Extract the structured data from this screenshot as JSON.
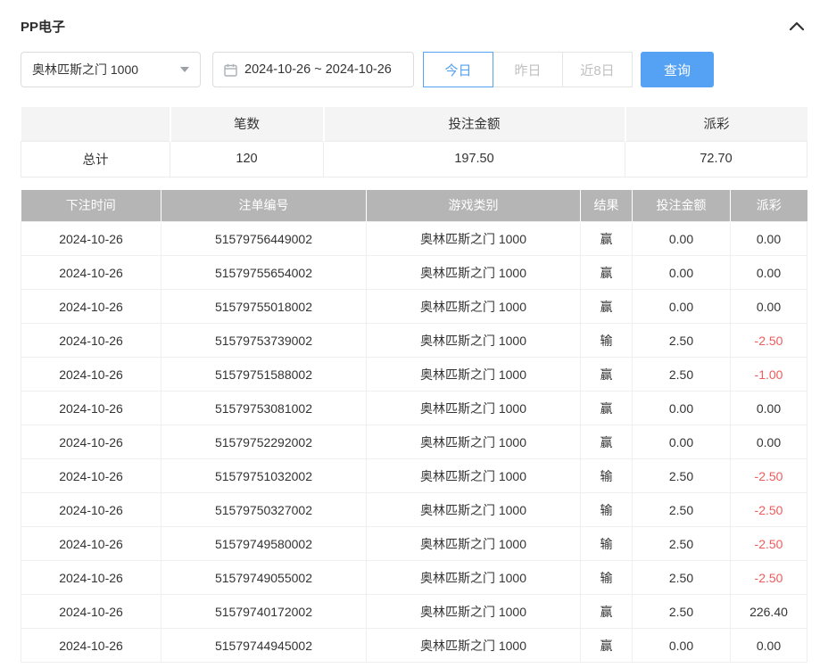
{
  "header": {
    "title": "PP电子"
  },
  "filters": {
    "game_select": {
      "value": "奥林匹斯之门 1000"
    },
    "date_range": {
      "value": "2024-10-26 ~ 2024-10-26"
    },
    "quick_buttons": [
      {
        "label": "今日",
        "active": true
      },
      {
        "label": "昨日",
        "active": false
      },
      {
        "label": "近8日",
        "active": false
      }
    ],
    "query_label": "查询"
  },
  "summary": {
    "columns": {
      "count": "笔数",
      "bet_amount": "投注金额",
      "payout": "派彩"
    },
    "total": {
      "label": "总计",
      "count": "120",
      "bet_amount": "197.50",
      "payout": "72.70"
    }
  },
  "table": {
    "columns": {
      "date": "下注时间",
      "order_id": "注单编号",
      "game": "游戏类别",
      "result": "结果",
      "bet": "投注金额",
      "payout": "派彩"
    },
    "rows": [
      {
        "date": "2024-10-26",
        "order_id": "51579756449002",
        "game": "奥林匹斯之门 1000",
        "result": "赢",
        "bet": "0.00",
        "payout": "0.00",
        "negative": false
      },
      {
        "date": "2024-10-26",
        "order_id": "51579755654002",
        "game": "奥林匹斯之门 1000",
        "result": "赢",
        "bet": "0.00",
        "payout": "0.00",
        "negative": false
      },
      {
        "date": "2024-10-26",
        "order_id": "51579755018002",
        "game": "奥林匹斯之门 1000",
        "result": "赢",
        "bet": "0.00",
        "payout": "0.00",
        "negative": false
      },
      {
        "date": "2024-10-26",
        "order_id": "51579753739002",
        "game": "奥林匹斯之门 1000",
        "result": "输",
        "bet": "2.50",
        "payout": "-2.50",
        "negative": true
      },
      {
        "date": "2024-10-26",
        "order_id": "51579751588002",
        "game": "奥林匹斯之门 1000",
        "result": "赢",
        "bet": "2.50",
        "payout": "-1.00",
        "negative": true
      },
      {
        "date": "2024-10-26",
        "order_id": "51579753081002",
        "game": "奥林匹斯之门 1000",
        "result": "赢",
        "bet": "0.00",
        "payout": "0.00",
        "negative": false
      },
      {
        "date": "2024-10-26",
        "order_id": "51579752292002",
        "game": "奥林匹斯之门 1000",
        "result": "赢",
        "bet": "0.00",
        "payout": "0.00",
        "negative": false
      },
      {
        "date": "2024-10-26",
        "order_id": "51579751032002",
        "game": "奥林匹斯之门 1000",
        "result": "输",
        "bet": "2.50",
        "payout": "-2.50",
        "negative": true
      },
      {
        "date": "2024-10-26",
        "order_id": "51579750327002",
        "game": "奥林匹斯之门 1000",
        "result": "输",
        "bet": "2.50",
        "payout": "-2.50",
        "negative": true
      },
      {
        "date": "2024-10-26",
        "order_id": "51579749580002",
        "game": "奥林匹斯之门 1000",
        "result": "输",
        "bet": "2.50",
        "payout": "-2.50",
        "negative": true
      },
      {
        "date": "2024-10-26",
        "order_id": "51579749055002",
        "game": "奥林匹斯之门 1000",
        "result": "输",
        "bet": "2.50",
        "payout": "-2.50",
        "negative": true
      },
      {
        "date": "2024-10-26",
        "order_id": "51579740172002",
        "game": "奥林匹斯之门 1000",
        "result": "赢",
        "bet": "2.50",
        "payout": "226.40",
        "negative": false
      },
      {
        "date": "2024-10-26",
        "order_id": "51579744945002",
        "game": "奥林匹斯之门 1000",
        "result": "赢",
        "bet": "0.00",
        "payout": "0.00",
        "negative": false
      }
    ]
  },
  "colors": {
    "accent": "#55a1f3",
    "negative": "#f15b5b",
    "table_head_bg": "#b5b5b5",
    "summary_head_bg": "#f4f4f4"
  }
}
